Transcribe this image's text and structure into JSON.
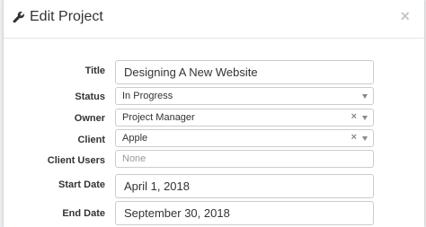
{
  "dialog": {
    "title": "Edit Project",
    "close_glyph": "×",
    "title_icon": "wrench-icon"
  },
  "fields": {
    "title": {
      "label": "Title",
      "value": "Designing A New Website"
    },
    "status": {
      "label": "Status",
      "value": "In Progress"
    },
    "owner": {
      "label": "Owner",
      "value": "Project Manager",
      "clear_glyph": "×"
    },
    "client": {
      "label": "Client",
      "value": "Apple",
      "clear_glyph": "×"
    },
    "client_users": {
      "label": "Client Users",
      "placeholder": "None"
    },
    "start_date": {
      "label": "Start Date",
      "value": "April 1, 2018"
    },
    "end_date": {
      "label": "End Date",
      "value": "September 30, 2018"
    }
  }
}
